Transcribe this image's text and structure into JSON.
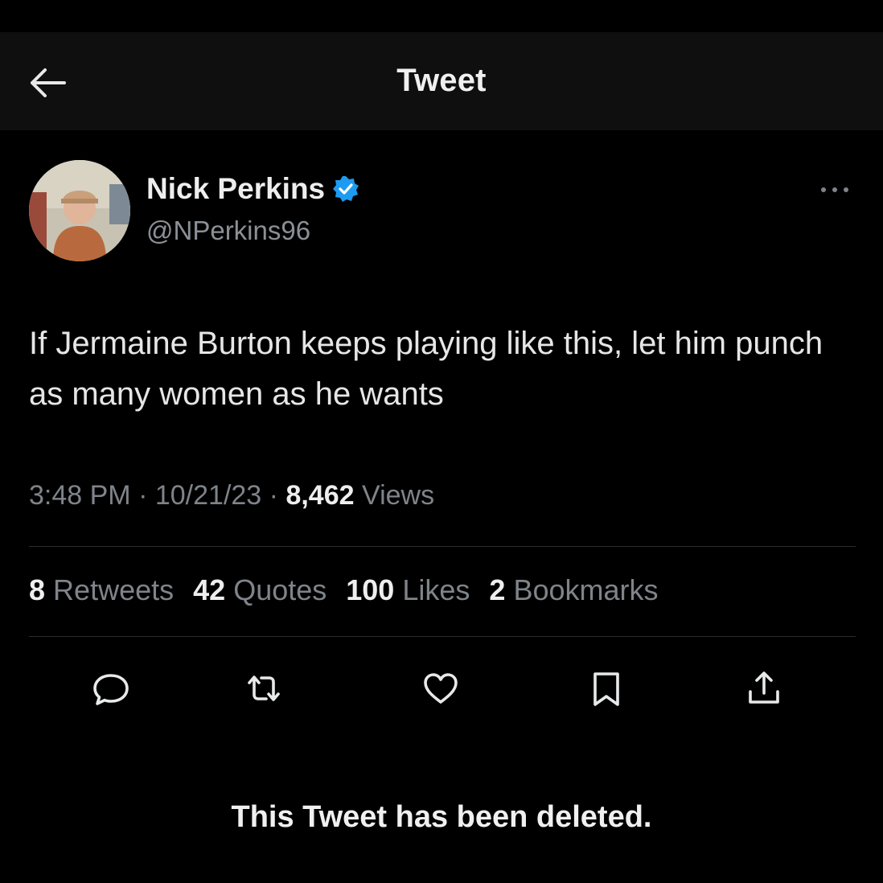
{
  "header": {
    "back_icon": "arrow-left-icon",
    "title": "Tweet"
  },
  "author": {
    "display_name": "Nick Perkins",
    "handle": "@NPerkins96",
    "verified_icon": "verified-badge-icon",
    "verified_color": "#1d9bf0"
  },
  "more_icon": "more-horizontal-icon",
  "tweet": {
    "text": "If Jermaine Burton keeps playing like this, let him punch as many women as he wants",
    "time": "3:48 PM",
    "date": "10/21/23",
    "separator": "·",
    "views_count": "8,462",
    "views_label": "Views"
  },
  "stats": [
    {
      "count": "8",
      "label": "Retweets"
    },
    {
      "count": "42",
      "label": "Quotes"
    },
    {
      "count": "100",
      "label": "Likes"
    },
    {
      "count": "2",
      "label": "Bookmarks"
    }
  ],
  "actions": [
    {
      "icon": "reply-icon"
    },
    {
      "icon": "retweet-icon"
    },
    {
      "icon": "like-icon"
    },
    {
      "icon": "bookmark-icon"
    },
    {
      "icon": "share-icon"
    }
  ],
  "notice": "This Tweet has been deleted."
}
